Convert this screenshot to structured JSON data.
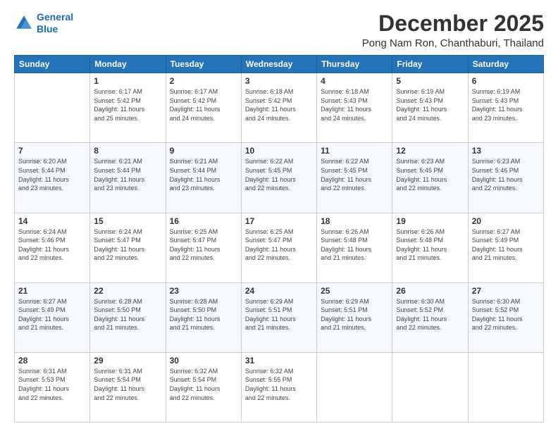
{
  "header": {
    "logo_line1": "General",
    "logo_line2": "Blue",
    "month_title": "December 2025",
    "location": "Pong Nam Ron, Chanthaburi, Thailand"
  },
  "weekdays": [
    "Sunday",
    "Monday",
    "Tuesday",
    "Wednesday",
    "Thursday",
    "Friday",
    "Saturday"
  ],
  "weeks": [
    [
      {
        "day": "",
        "info": ""
      },
      {
        "day": "1",
        "info": "Sunrise: 6:17 AM\nSunset: 5:42 PM\nDaylight: 11 hours\nand 25 minutes."
      },
      {
        "day": "2",
        "info": "Sunrise: 6:17 AM\nSunset: 5:42 PM\nDaylight: 11 hours\nand 24 minutes."
      },
      {
        "day": "3",
        "info": "Sunrise: 6:18 AM\nSunset: 5:42 PM\nDaylight: 11 hours\nand 24 minutes."
      },
      {
        "day": "4",
        "info": "Sunrise: 6:18 AM\nSunset: 5:43 PM\nDaylight: 11 hours\nand 24 minutes."
      },
      {
        "day": "5",
        "info": "Sunrise: 6:19 AM\nSunset: 5:43 PM\nDaylight: 11 hours\nand 24 minutes."
      },
      {
        "day": "6",
        "info": "Sunrise: 6:19 AM\nSunset: 5:43 PM\nDaylight: 11 hours\nand 23 minutes."
      }
    ],
    [
      {
        "day": "7",
        "info": "Sunrise: 6:20 AM\nSunset: 5:44 PM\nDaylight: 11 hours\nand 23 minutes."
      },
      {
        "day": "8",
        "info": "Sunrise: 6:21 AM\nSunset: 5:44 PM\nDaylight: 11 hours\nand 23 minutes."
      },
      {
        "day": "9",
        "info": "Sunrise: 6:21 AM\nSunset: 5:44 PM\nDaylight: 11 hours\nand 23 minutes."
      },
      {
        "day": "10",
        "info": "Sunrise: 6:22 AM\nSunset: 5:45 PM\nDaylight: 11 hours\nand 22 minutes."
      },
      {
        "day": "11",
        "info": "Sunrise: 6:22 AM\nSunset: 5:45 PM\nDaylight: 11 hours\nand 22 minutes."
      },
      {
        "day": "12",
        "info": "Sunrise: 6:23 AM\nSunset: 5:45 PM\nDaylight: 11 hours\nand 22 minutes."
      },
      {
        "day": "13",
        "info": "Sunrise: 6:23 AM\nSunset: 5:46 PM\nDaylight: 11 hours\nand 22 minutes."
      }
    ],
    [
      {
        "day": "14",
        "info": "Sunrise: 6:24 AM\nSunset: 5:46 PM\nDaylight: 11 hours\nand 22 minutes."
      },
      {
        "day": "15",
        "info": "Sunrise: 6:24 AM\nSunset: 5:47 PM\nDaylight: 11 hours\nand 22 minutes."
      },
      {
        "day": "16",
        "info": "Sunrise: 6:25 AM\nSunset: 5:47 PM\nDaylight: 11 hours\nand 22 minutes."
      },
      {
        "day": "17",
        "info": "Sunrise: 6:25 AM\nSunset: 5:47 PM\nDaylight: 11 hours\nand 22 minutes."
      },
      {
        "day": "18",
        "info": "Sunrise: 6:26 AM\nSunset: 5:48 PM\nDaylight: 11 hours\nand 21 minutes."
      },
      {
        "day": "19",
        "info": "Sunrise: 6:26 AM\nSunset: 5:48 PM\nDaylight: 11 hours\nand 21 minutes."
      },
      {
        "day": "20",
        "info": "Sunrise: 6:27 AM\nSunset: 5:49 PM\nDaylight: 11 hours\nand 21 minutes."
      }
    ],
    [
      {
        "day": "21",
        "info": "Sunrise: 6:27 AM\nSunset: 5:49 PM\nDaylight: 11 hours\nand 21 minutes."
      },
      {
        "day": "22",
        "info": "Sunrise: 6:28 AM\nSunset: 5:50 PM\nDaylight: 11 hours\nand 21 minutes."
      },
      {
        "day": "23",
        "info": "Sunrise: 6:28 AM\nSunset: 5:50 PM\nDaylight: 11 hours\nand 21 minutes."
      },
      {
        "day": "24",
        "info": "Sunrise: 6:29 AM\nSunset: 5:51 PM\nDaylight: 11 hours\nand 21 minutes."
      },
      {
        "day": "25",
        "info": "Sunrise: 6:29 AM\nSunset: 5:51 PM\nDaylight: 11 hours\nand 21 minutes."
      },
      {
        "day": "26",
        "info": "Sunrise: 6:30 AM\nSunset: 5:52 PM\nDaylight: 11 hours\nand 22 minutes."
      },
      {
        "day": "27",
        "info": "Sunrise: 6:30 AM\nSunset: 5:52 PM\nDaylight: 11 hours\nand 22 minutes."
      }
    ],
    [
      {
        "day": "28",
        "info": "Sunrise: 6:31 AM\nSunset: 5:53 PM\nDaylight: 11 hours\nand 22 minutes."
      },
      {
        "day": "29",
        "info": "Sunrise: 6:31 AM\nSunset: 5:54 PM\nDaylight: 11 hours\nand 22 minutes."
      },
      {
        "day": "30",
        "info": "Sunrise: 6:32 AM\nSunset: 5:54 PM\nDaylight: 11 hours\nand 22 minutes."
      },
      {
        "day": "31",
        "info": "Sunrise: 6:32 AM\nSunset: 5:55 PM\nDaylight: 11 hours\nand 22 minutes."
      },
      {
        "day": "",
        "info": ""
      },
      {
        "day": "",
        "info": ""
      },
      {
        "day": "",
        "info": ""
      }
    ]
  ]
}
